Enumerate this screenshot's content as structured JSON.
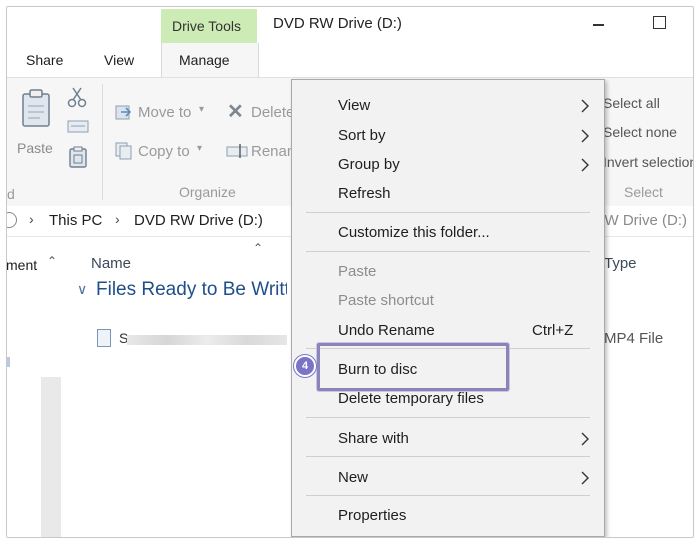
{
  "window": {
    "title": "DVD RW Drive (D:)",
    "context_tab": "Drive Tools"
  },
  "ribbon": {
    "tabs": [
      {
        "label": "Share"
      },
      {
        "label": "View"
      },
      {
        "label": "Manage"
      }
    ],
    "paste_label": "Paste",
    "move_to_label": "Move to",
    "copy_to_label": "Copy to",
    "delete_label": "Delete",
    "rename_label": "Rename",
    "organize_group": "Organize",
    "select_all": "Select all",
    "select_none": "Select none",
    "invert_selection": "Invert selection",
    "select_group": "Select"
  },
  "address": {
    "this_pc": "This PC",
    "drive": "DVD RW Drive (D:)",
    "search_placeholder": "Search DVD RW Drive (D:)"
  },
  "columns": {
    "name": "Name",
    "type": "Type",
    "nav_label": "ment"
  },
  "files": {
    "group_header": "Files Ready to Be Written to the Disc",
    "items": [
      {
        "name": "S",
        "type": "MP4 File"
      }
    ]
  },
  "context_menu": {
    "items": [
      {
        "label": "View",
        "submenu": true
      },
      {
        "label": "Sort by",
        "submenu": true
      },
      {
        "label": "Group by",
        "submenu": true
      },
      {
        "label": "Refresh"
      },
      {
        "label": "Customize this folder..."
      },
      {
        "label": "Paste",
        "disabled": true
      },
      {
        "label": "Paste shortcut",
        "disabled": true
      },
      {
        "label": "Undo Rename",
        "shortcut": "Ctrl+Z"
      },
      {
        "label": "Burn to disc"
      },
      {
        "label": "Delete temporary files"
      },
      {
        "label": "Share with",
        "submenu": true
      },
      {
        "label": "New",
        "submenu": true
      },
      {
        "label": "Properties"
      }
    ],
    "step_number": "4"
  },
  "colors": {
    "drive_tools_band": "#cdebb5",
    "highlight": "#8a84b8",
    "badge": "#7a73c6"
  }
}
